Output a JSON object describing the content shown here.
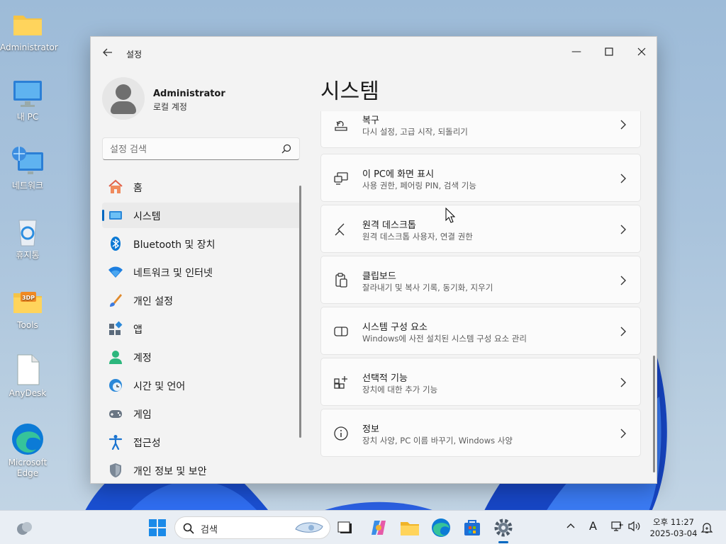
{
  "desktop": {
    "icons": [
      {
        "label": "Administrator",
        "icon": "folder-icon"
      },
      {
        "label": "내 PC",
        "icon": "computer-icon"
      },
      {
        "label": "네트워크",
        "icon": "network-icon"
      },
      {
        "label": "휴지통",
        "icon": "recycle-bin-icon"
      },
      {
        "label": "Tools",
        "icon": "tools-folder-icon",
        "badge": "3DP"
      },
      {
        "label": "AnyDesk",
        "icon": "file-icon"
      },
      {
        "label": "Microsoft Edge",
        "icon": "edge-icon"
      }
    ]
  },
  "window": {
    "title": "설정",
    "controls": {
      "minimize": "—",
      "maximize": "☐",
      "close": "✕"
    },
    "profile": {
      "name": "Administrator",
      "account_type": "로컬 계정"
    },
    "search": {
      "placeholder": "설정 검색"
    },
    "nav": [
      {
        "label": "홈",
        "icon": "home-icon"
      },
      {
        "label": "시스템",
        "icon": "system-icon",
        "active": true
      },
      {
        "label": "Bluetooth 및 장치",
        "icon": "bluetooth-icon"
      },
      {
        "label": "네트워크 및 인터넷",
        "icon": "wifi-icon"
      },
      {
        "label": "개인 설정",
        "icon": "brush-icon"
      },
      {
        "label": "앱",
        "icon": "apps-icon"
      },
      {
        "label": "계정",
        "icon": "account-icon"
      },
      {
        "label": "시간 및 언어",
        "icon": "clock-globe-icon"
      },
      {
        "label": "게임",
        "icon": "gamepad-icon"
      },
      {
        "label": "접근성",
        "icon": "accessibility-icon"
      },
      {
        "label": "개인 정보 및 보안",
        "icon": "shield-icon"
      }
    ],
    "page_title": "시스템",
    "cards": [
      {
        "title": "복구",
        "subtitle": "다시 설정, 고급 시작, 되돌리기",
        "icon": "recovery-icon"
      },
      {
        "title": "이 PC에 화면 표시",
        "subtitle": "사용 권한, 페어링 PIN, 검색 기능",
        "icon": "project-icon"
      },
      {
        "title": "원격 데스크톱",
        "subtitle": "원격 데스크톱 사용자, 연결 권한",
        "icon": "remote-desktop-icon"
      },
      {
        "title": "클립보드",
        "subtitle": "잘라내기 및 복사 기록, 동기화, 지우기",
        "icon": "clipboard-icon"
      },
      {
        "title": "시스템 구성 요소",
        "subtitle": "Windows에 사전 설치된 시스템 구성 요소 관리",
        "icon": "components-icon"
      },
      {
        "title": "선택적 기능",
        "subtitle": "장치에 대한 추가 기능",
        "icon": "optional-features-icon"
      },
      {
        "title": "정보",
        "subtitle": "장치 사양, PC 이름 바꾸기, Windows 사양",
        "icon": "info-icon"
      }
    ]
  },
  "taskbar": {
    "search_label": "검색",
    "clock": {
      "ampm_time": "오후 11:27",
      "date": "2025-03-04"
    },
    "tray": {
      "chevron": "^",
      "ime": "A"
    }
  },
  "colors": {
    "accent": "#0067c0",
    "bg": "#f3f3f3",
    "card": "#fbfbfb"
  }
}
